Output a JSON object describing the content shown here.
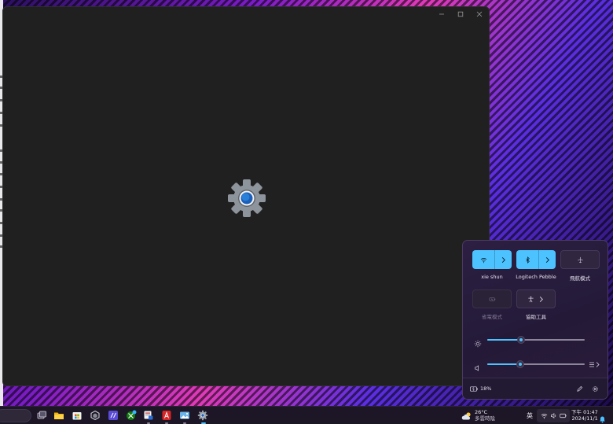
{
  "quick_settings": {
    "wifi": {
      "label": "xie shun",
      "state": "on"
    },
    "bluetooth": {
      "label": "Logitech Pebble",
      "state": "on"
    },
    "airplane": {
      "label": "飛航模式",
      "state": "off"
    },
    "battery_saver": {
      "label": "省電模式",
      "state": "disabled"
    },
    "accessibility": {
      "label": "協助工具",
      "state": "off"
    },
    "brightness": {
      "level": 0.35
    },
    "volume": {
      "level": 0.34
    },
    "battery_percent": "18%"
  },
  "taskbar": {
    "weather_temp": "26°C",
    "weather_desc": "多雲時陰",
    "ime_indicator": "英",
    "clock_time": "下午 01:47",
    "clock_date": "2024/11/1"
  },
  "colors": {
    "accent": "#4cc2ff",
    "window_bg": "#202020",
    "panel_bg": "#2c1f42"
  },
  "icons": {
    "splash": "settings-gear-icon",
    "taskbar": [
      "task-view-icon",
      "file-explorer-icon",
      "microsoft-store-icon",
      "app-icon",
      "visual-studio-code-icon",
      "xbox-icon",
      "snipping-tool-icon",
      "acrobat-icon",
      "photos-icon",
      "settings-icon"
    ]
  }
}
